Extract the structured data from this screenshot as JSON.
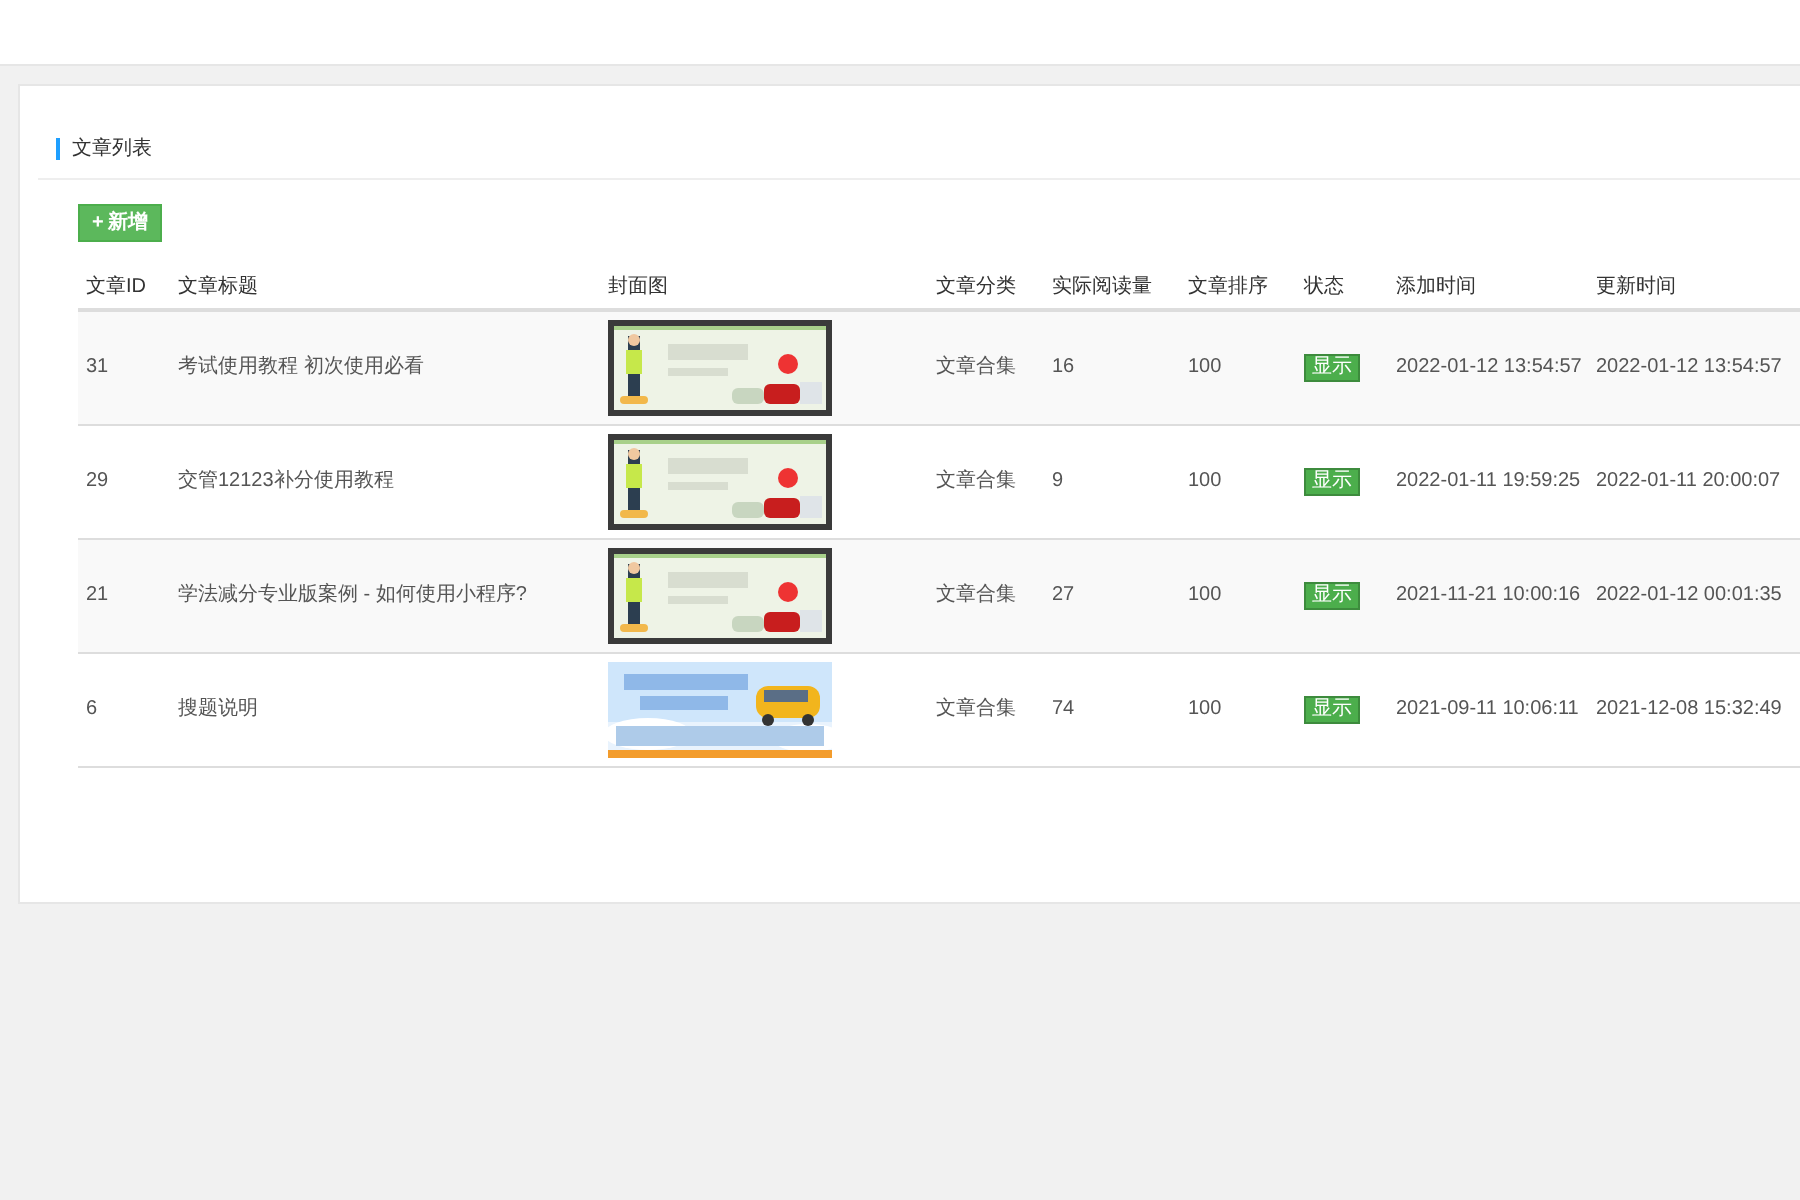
{
  "panel": {
    "title": "文章列表"
  },
  "add_button": {
    "icon": "+",
    "label": "新增"
  },
  "table": {
    "columns": [
      "文章ID",
      "文章标题",
      "封面图",
      "文章分类",
      "实际阅读量",
      "文章排序",
      "状态",
      "添加时间",
      "更新时间"
    ],
    "rows": [
      {
        "id": "31",
        "title": "考试使用教程 初次使用必看",
        "category": "文章合集",
        "reads": "16",
        "order": "100",
        "status": "显示",
        "added": "2022-01-12 13:54:57",
        "updated": "2022-01-12 13:54:57"
      },
      {
        "id": "29",
        "title": "交管12123补分使用教程",
        "category": "文章合集",
        "reads": "9",
        "order": "100",
        "status": "显示",
        "added": "2022-01-11 19:59:25",
        "updated": "2022-01-11 20:00:07"
      },
      {
        "id": "21",
        "title": "学法减分专业版案例 - 如何使用小程序?",
        "category": "文章合集",
        "reads": "27",
        "order": "100",
        "status": "显示",
        "added": "2021-11-21 10:00:16",
        "updated": "2022-01-12 00:01:35"
      },
      {
        "id": "6",
        "title": "搜题说明",
        "category": "文章合集",
        "reads": "74",
        "order": "100",
        "status": "显示",
        "added": "2021-09-11 10:06:11",
        "updated": "2021-12-08 15:32:49"
      }
    ]
  }
}
